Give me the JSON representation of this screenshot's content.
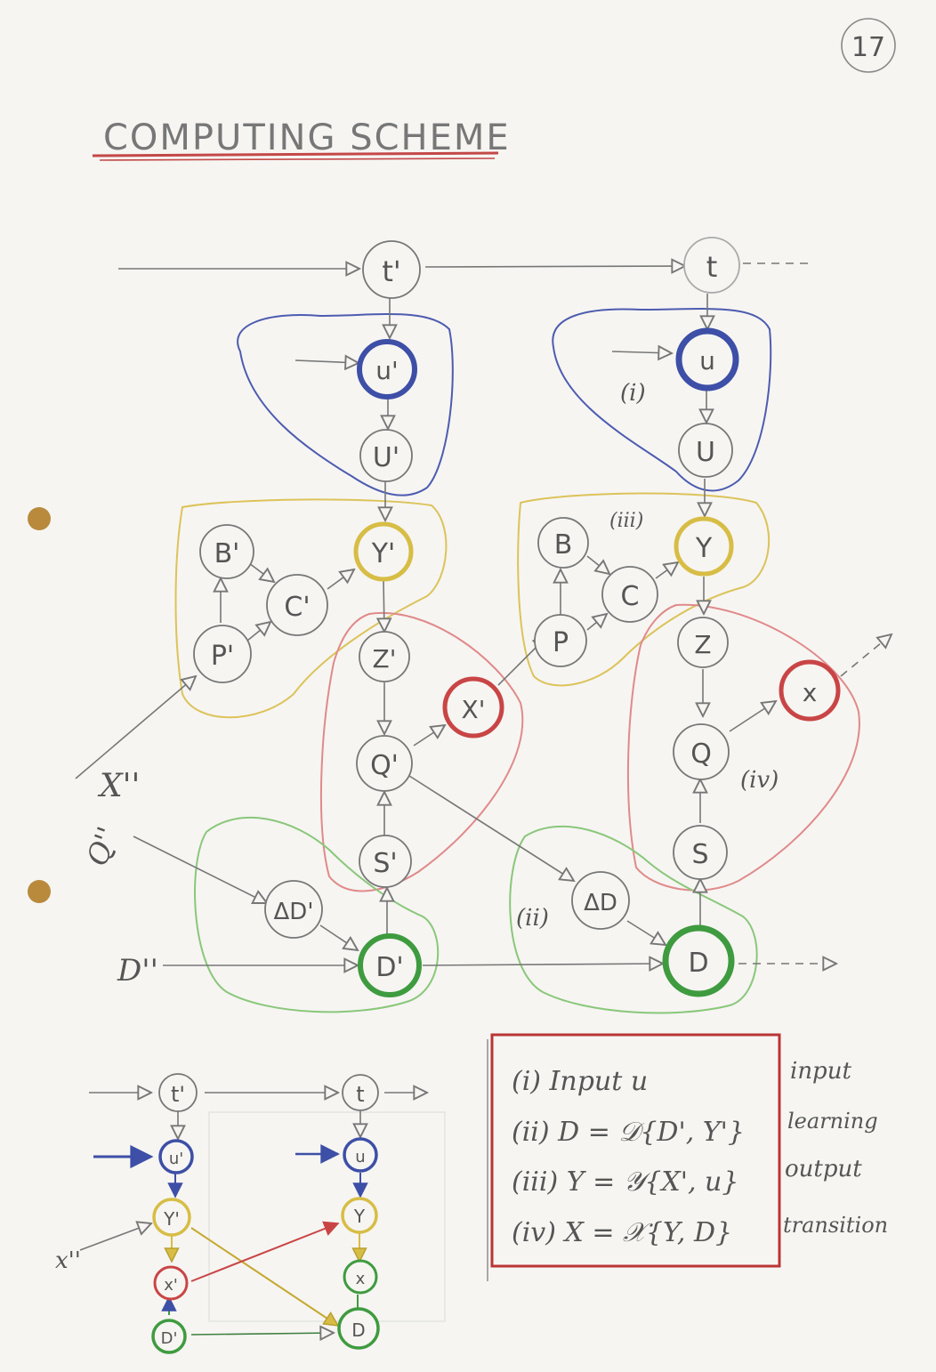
{
  "page_number": "17",
  "title": "COMPUTING SCHEME",
  "colors": {
    "ink": "#777777",
    "blue": "#3d4fa6",
    "yellow": "#d7bd45",
    "red": "#c94545",
    "green": "#3f9b3f",
    "red_underline": "#c44848",
    "box": "#b93535"
  },
  "inputs": {
    "x_prev": "X''",
    "q_prev": "Q''",
    "d_prev": "D''"
  },
  "left_column": {
    "t": "t'",
    "u_small": "u'",
    "U": "U'",
    "Y": "Y'",
    "B": "B'",
    "C": "C'",
    "P": "P'",
    "Z": "Z'",
    "X": "X'",
    "Q": "Q'",
    "S": "S'",
    "dD": "ΔD'",
    "D": "D'"
  },
  "right_column": {
    "t": "t",
    "u_small": "u",
    "U": "U",
    "Y": "Y",
    "B": "B",
    "C": "C",
    "P": "P",
    "Z": "Z",
    "X": "x",
    "Q": "Q",
    "S": "S",
    "dD": "ΔD",
    "D": "D"
  },
  "region_labels": {
    "i": "(i)",
    "ii": "(ii)",
    "iii": "(iii)",
    "iv": "(iv)"
  },
  "mini_scheme": {
    "t_left": "t'",
    "t_right": "t",
    "u_left": "u'",
    "u_right": "u",
    "y_left": "Y'",
    "y_right": "Y",
    "x_left": "x'",
    "x_right": "x",
    "d_left": "D'",
    "d_right": "D",
    "x_input": "x''"
  },
  "legend": {
    "rows": [
      {
        "formula": "(i) Input u",
        "desc": "input"
      },
      {
        "formula": "(ii) D = 𝒟{D', Y'}",
        "desc": "learning"
      },
      {
        "formula": "(iii) Y = 𝒴{X', u}",
        "desc": "output"
      },
      {
        "formula": "(iv) X = 𝒳{Y, D}",
        "desc": "transition"
      }
    ]
  }
}
